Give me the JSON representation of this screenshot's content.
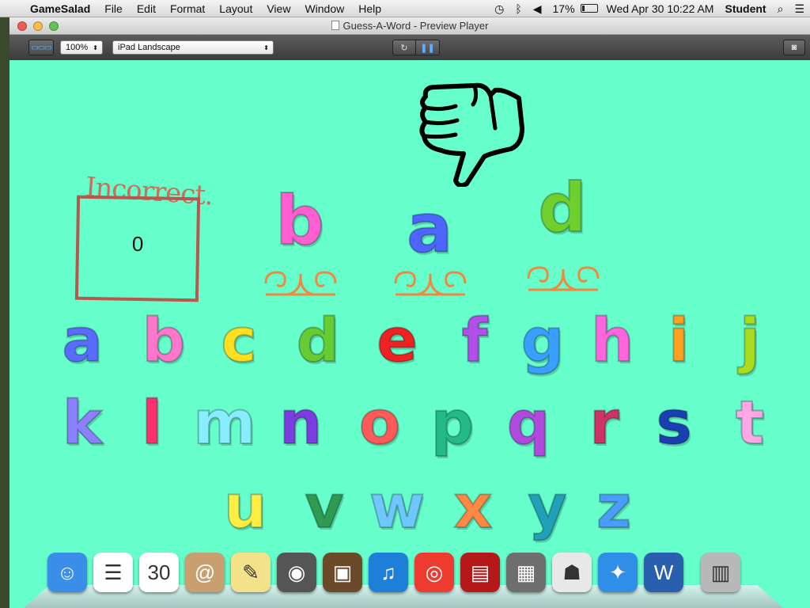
{
  "menubar": {
    "apple": "",
    "app_name": "GameSalad",
    "items": [
      "File",
      "Edit",
      "Format",
      "Layout",
      "View",
      "Window",
      "Help"
    ],
    "battery": "17%",
    "clock": "Wed Apr 30  10:22 AM",
    "user": "Student"
  },
  "window": {
    "title": "Guess-A-Word  - Preview Player"
  },
  "toolbar": {
    "zoom": "100%",
    "device": "iPad Landscape"
  },
  "game": {
    "incorrect_label": "Incorrect.",
    "incorrect_count": "0",
    "guessed_letters": [
      "b",
      "a",
      "d"
    ],
    "guessed_colors": [
      "#ff5fd0",
      "#4c66ff",
      "#6fcf2f"
    ],
    "keyboard_row1": [
      "a",
      "b",
      "c",
      "d",
      "e",
      "f",
      "g",
      "h",
      "i",
      "j"
    ],
    "keyboard_row2": [
      "k",
      "l",
      "m",
      "n",
      "o",
      "p",
      "q",
      "r",
      "s",
      "t"
    ],
    "keyboard_row3": [
      "u",
      "v",
      "w",
      "x",
      "y",
      "z"
    ],
    "colors_row1": [
      "#5a6cff",
      "#ff77cc",
      "#ffe020",
      "#66cc33",
      "#ee2222",
      "#b050e8",
      "#3aa0ff",
      "#ff66dd",
      "#ffa020",
      "#aadd22"
    ],
    "colors_row2": [
      "#8c80ff",
      "#ff3070",
      "#88eeff",
      "#7b3de0",
      "#ff5a5a",
      "#22bb88",
      "#b04adf",
      "#cc3366",
      "#1a3fb0",
      "#ffa8e8"
    ],
    "colors_row3": [
      "#ffee44",
      "#2f9a52",
      "#6ec8ff",
      "#ff8844",
      "#22a0b8",
      "#4a9cff"
    ]
  },
  "dock": {
    "icons": [
      {
        "name": "finder-icon",
        "glyph": "☺",
        "color": "#3a8ee8"
      },
      {
        "name": "reminders-icon",
        "glyph": "☰",
        "color": "#ffffff"
      },
      {
        "name": "calendar-icon",
        "glyph": "30",
        "color": "#ffffff"
      },
      {
        "name": "contacts-icon",
        "glyph": "@",
        "color": "#c8a070"
      },
      {
        "name": "notes-icon",
        "glyph": "✎",
        "color": "#f4e28a"
      },
      {
        "name": "facetime-icon",
        "glyph": "◉",
        "color": "#555555"
      },
      {
        "name": "iphoto-icon",
        "glyph": "▣",
        "color": "#6b4a2a"
      },
      {
        "name": "itunes-icon",
        "glyph": "♫",
        "color": "#1e7fd8"
      },
      {
        "name": "chrome-icon",
        "glyph": "◎",
        "color": "#ee3b30"
      },
      {
        "name": "photobooth-icon",
        "glyph": "▤",
        "color": "#b41818"
      },
      {
        "name": "image-capture-icon",
        "glyph": "▦",
        "color": "#6e6e6e"
      },
      {
        "name": "gamesalad-icon",
        "glyph": "☗",
        "color": "#e8e8e8"
      },
      {
        "name": "safari-icon",
        "glyph": "✦",
        "color": "#2f8ee8"
      },
      {
        "name": "word-icon",
        "glyph": "W",
        "color": "#2a5fb0"
      },
      {
        "name": "trash-icon",
        "glyph": "▥",
        "color": "#b8b8b8"
      }
    ]
  }
}
